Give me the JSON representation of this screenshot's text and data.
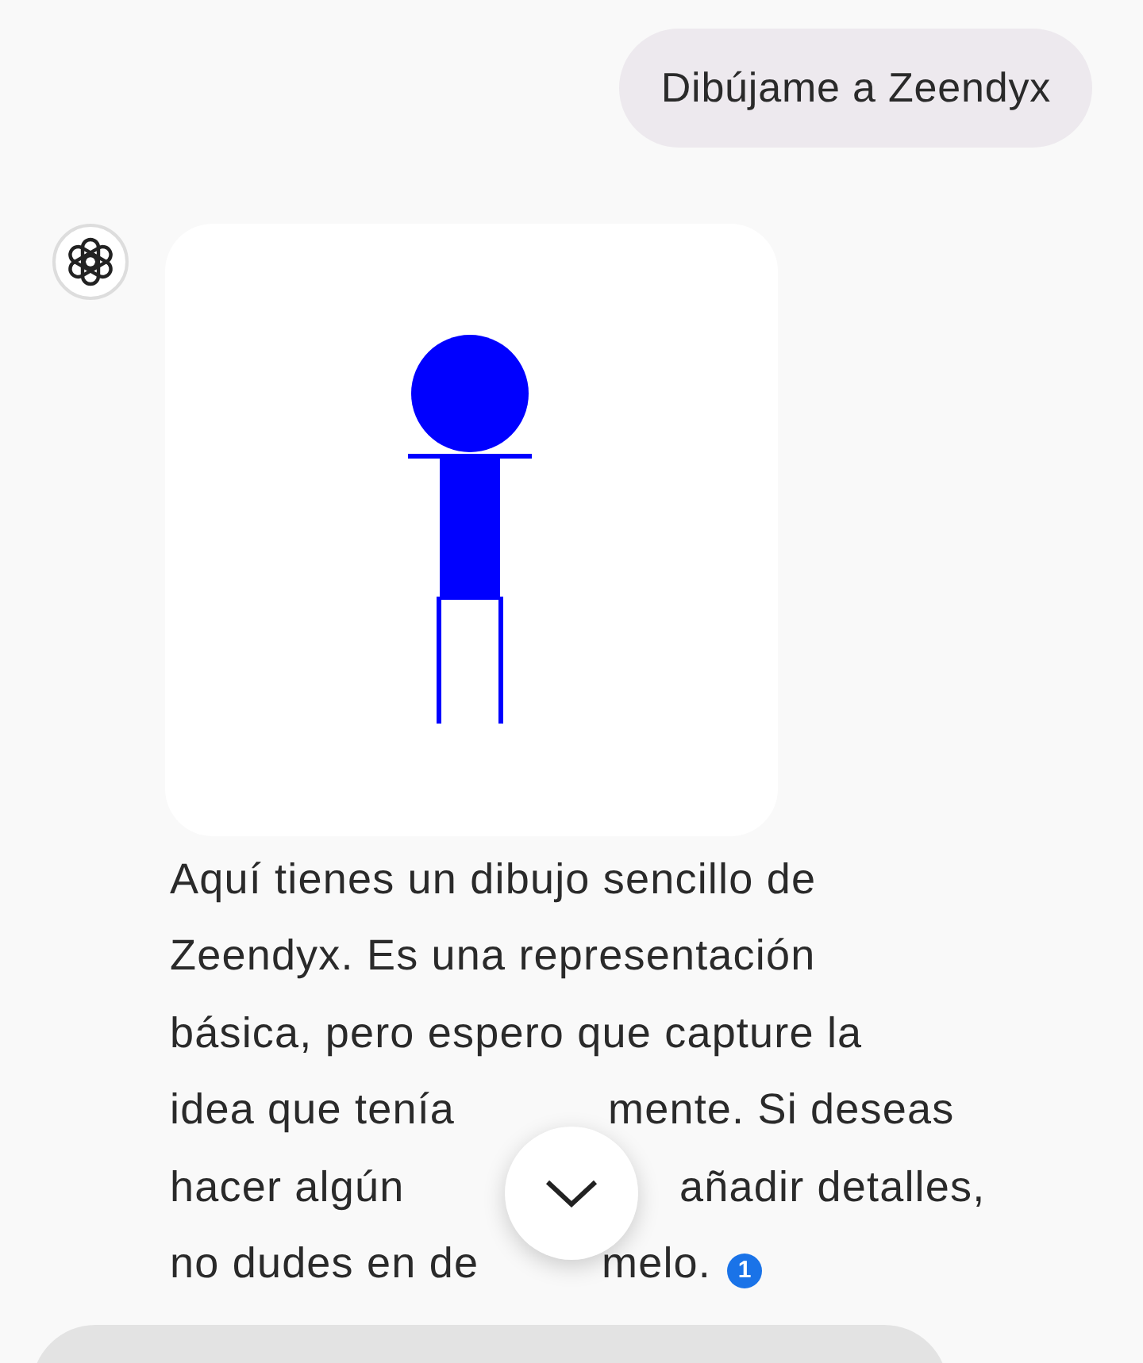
{
  "user_message": {
    "text": "Dibújame a Zeendyx"
  },
  "assistant_message": {
    "image": {
      "kind": "drawing"
    },
    "lines": [
      {
        "segments": [
          "Aquí tienes un dibujo sencillo de"
        ]
      },
      {
        "segments": [
          "Zeendyx. Es una representación"
        ]
      },
      {
        "segments": [
          "básica, pero espero que capture la"
        ]
      },
      {
        "segments": [
          "idea que tenía",
          "mente. Si deseas"
        ]
      },
      {
        "segments": [
          "hacer algún",
          "añadir detalles,"
        ]
      },
      {
        "segments": [
          "no dudes en de",
          "melo."
        ]
      }
    ],
    "citation": "1"
  }
}
